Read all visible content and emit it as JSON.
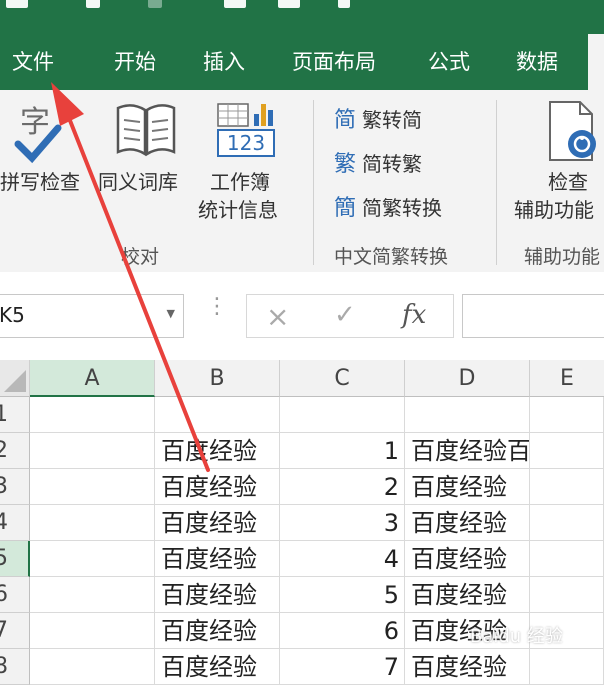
{
  "menu": {
    "tabs": [
      "文件",
      "开始",
      "插入",
      "页面布局",
      "公式",
      "数据"
    ]
  },
  "ribbon": {
    "spell_check": "拼写检查",
    "thesaurus": "同义词库",
    "workbook_stats_line1": "工作簿",
    "workbook_stats_line2": "统计信息",
    "workbook_stats_icon_text": "123",
    "proofing_group": "校对",
    "to_traditional": "繁转简",
    "to_simplified": "简转繁",
    "convert": "简繁转换",
    "chinese_conversion_group": "中文简繁转换",
    "check_line1": "检查",
    "check_line2": "辅助功能",
    "accessibility_group": "辅助功能",
    "glyph_jian": "简",
    "glyph_fan": "繁",
    "glyph_combo": "簡",
    "glyph_zi": "字"
  },
  "formula_bar": {
    "name_box": "K5",
    "cancel_symbol": "×",
    "enter_symbol": "✓",
    "fx_symbol": "fx",
    "formula_value": ""
  },
  "sheet": {
    "columns": [
      "A",
      "B",
      "C",
      "D",
      "E"
    ],
    "rows": [
      {
        "num": "1",
        "a": "",
        "b": "",
        "c": "",
        "d": ""
      },
      {
        "num": "2",
        "a": "",
        "b": "百度经验",
        "c": "1",
        "d": "百度经验百"
      },
      {
        "num": "3",
        "a": "",
        "b": "百度经验",
        "c": "2",
        "d": "百度经验"
      },
      {
        "num": "4",
        "a": "",
        "b": "百度经验",
        "c": "3",
        "d": "百度经验"
      },
      {
        "num": "5",
        "a": "",
        "b": "百度经验",
        "c": "4",
        "d": "百度经验"
      },
      {
        "num": "6",
        "a": "",
        "b": "百度经验",
        "c": "5",
        "d": "百度经验"
      },
      {
        "num": "7",
        "a": "",
        "b": "百度经验",
        "c": "6",
        "d": "百度经验"
      },
      {
        "num": "8",
        "a": "",
        "b": "百度经验",
        "c": "7",
        "d": "百度经验"
      }
    ]
  },
  "watermark": "Baidu 经验",
  "colors": {
    "excel_green": "#217346",
    "annotation_arrow": "#e8413c",
    "selected_header": "#d3e9da"
  }
}
